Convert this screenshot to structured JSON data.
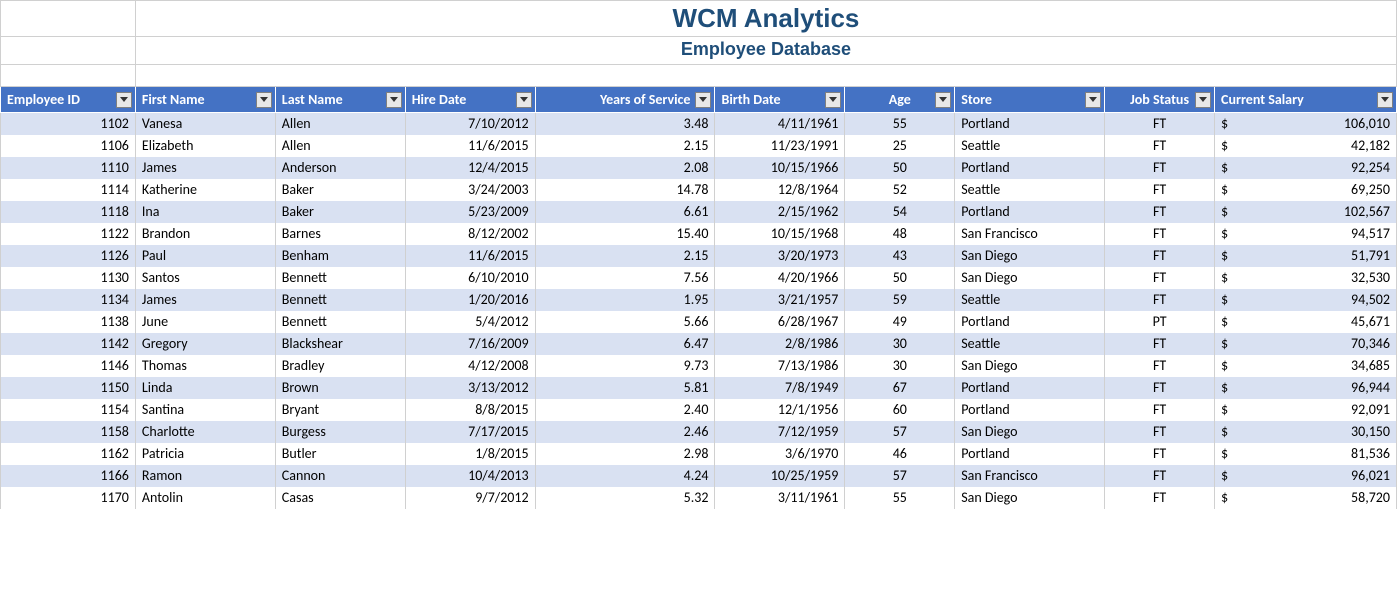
{
  "title": "WCM Analytics",
  "subtitle": "Employee Database",
  "currency_symbol": "$",
  "columns": [
    {
      "key": "emp_id",
      "label": "Employee ID",
      "align": "left"
    },
    {
      "key": "first",
      "label": "First Name",
      "align": "left"
    },
    {
      "key": "last",
      "label": "Last Name",
      "align": "left"
    },
    {
      "key": "hire",
      "label": "Hire Date",
      "align": "left"
    },
    {
      "key": "yos",
      "label": "Years of Service",
      "align": "right"
    },
    {
      "key": "birth",
      "label": "Birth Date",
      "align": "left"
    },
    {
      "key": "age",
      "label": "Age",
      "align": "center"
    },
    {
      "key": "store",
      "label": "Store",
      "align": "left"
    },
    {
      "key": "job",
      "label": "Job Status",
      "align": "center"
    },
    {
      "key": "salary",
      "label": "Current Salary",
      "align": "left"
    }
  ],
  "rows": [
    {
      "emp_id": "1102",
      "first": "Vanesa",
      "last": "Allen",
      "hire": "7/10/2012",
      "yos": "3.48",
      "birth": "4/11/1961",
      "age": "55",
      "store": "Portland",
      "job": "FT",
      "salary": "106,010"
    },
    {
      "emp_id": "1106",
      "first": "Elizabeth",
      "last": "Allen",
      "hire": "11/6/2015",
      "yos": "2.15",
      "birth": "11/23/1991",
      "age": "25",
      "store": "Seattle",
      "job": "FT",
      "salary": "42,182"
    },
    {
      "emp_id": "1110",
      "first": "James",
      "last": "Anderson",
      "hire": "12/4/2015",
      "yos": "2.08",
      "birth": "10/15/1966",
      "age": "50",
      "store": "Portland",
      "job": "FT",
      "salary": "92,254"
    },
    {
      "emp_id": "1114",
      "first": "Katherine",
      "last": "Baker",
      "hire": "3/24/2003",
      "yos": "14.78",
      "birth": "12/8/1964",
      "age": "52",
      "store": "Seattle",
      "job": "FT",
      "salary": "69,250"
    },
    {
      "emp_id": "1118",
      "first": "Ina",
      "last": "Baker",
      "hire": "5/23/2009",
      "yos": "6.61",
      "birth": "2/15/1962",
      "age": "54",
      "store": "Portland",
      "job": "FT",
      "salary": "102,567"
    },
    {
      "emp_id": "1122",
      "first": "Brandon",
      "last": "Barnes",
      "hire": "8/12/2002",
      "yos": "15.40",
      "birth": "10/15/1968",
      "age": "48",
      "store": "San Francisco",
      "job": "FT",
      "salary": "94,517"
    },
    {
      "emp_id": "1126",
      "first": "Paul",
      "last": "Benham",
      "hire": "11/6/2015",
      "yos": "2.15",
      "birth": "3/20/1973",
      "age": "43",
      "store": "San Diego",
      "job": "FT",
      "salary": "51,791"
    },
    {
      "emp_id": "1130",
      "first": "Santos",
      "last": "Bennett",
      "hire": "6/10/2010",
      "yos": "7.56",
      "birth": "4/20/1966",
      "age": "50",
      "store": "San Diego",
      "job": "FT",
      "salary": "32,530"
    },
    {
      "emp_id": "1134",
      "first": "James",
      "last": "Bennett",
      "hire": "1/20/2016",
      "yos": "1.95",
      "birth": "3/21/1957",
      "age": "59",
      "store": "Seattle",
      "job": "FT",
      "salary": "94,502"
    },
    {
      "emp_id": "1138",
      "first": "June",
      "last": "Bennett",
      "hire": "5/4/2012",
      "yos": "5.66",
      "birth": "6/28/1967",
      "age": "49",
      "store": "Portland",
      "job": "PT",
      "salary": "45,671"
    },
    {
      "emp_id": "1142",
      "first": "Gregory",
      "last": "Blackshear",
      "hire": "7/16/2009",
      "yos": "6.47",
      "birth": "2/8/1986",
      "age": "30",
      "store": "Seattle",
      "job": "FT",
      "salary": "70,346"
    },
    {
      "emp_id": "1146",
      "first": "Thomas",
      "last": "Bradley",
      "hire": "4/12/2008",
      "yos": "9.73",
      "birth": "7/13/1986",
      "age": "30",
      "store": "San Diego",
      "job": "FT",
      "salary": "34,685"
    },
    {
      "emp_id": "1150",
      "first": "Linda",
      "last": "Brown",
      "hire": "3/13/2012",
      "yos": "5.81",
      "birth": "7/8/1949",
      "age": "67",
      "store": "Portland",
      "job": "FT",
      "salary": "96,944"
    },
    {
      "emp_id": "1154",
      "first": "Santina",
      "last": "Bryant",
      "hire": "8/8/2015",
      "yos": "2.40",
      "birth": "12/1/1956",
      "age": "60",
      "store": "Portland",
      "job": "FT",
      "salary": "92,091"
    },
    {
      "emp_id": "1158",
      "first": "Charlotte",
      "last": "Burgess",
      "hire": "7/17/2015",
      "yos": "2.46",
      "birth": "7/12/1959",
      "age": "57",
      "store": "San Diego",
      "job": "FT",
      "salary": "30,150"
    },
    {
      "emp_id": "1162",
      "first": "Patricia",
      "last": "Butler",
      "hire": "1/8/2015",
      "yos": "2.98",
      "birth": "3/6/1970",
      "age": "46",
      "store": "Portland",
      "job": "FT",
      "salary": "81,536"
    },
    {
      "emp_id": "1166",
      "first": "Ramon",
      "last": "Cannon",
      "hire": "10/4/2013",
      "yos": "4.24",
      "birth": "10/25/1959",
      "age": "57",
      "store": "San Francisco",
      "job": "FT",
      "salary": "96,021"
    },
    {
      "emp_id": "1170",
      "first": "Antolin",
      "last": "Casas",
      "hire": "9/7/2012",
      "yos": "5.32",
      "birth": "3/11/1961",
      "age": "55",
      "store": "San Diego",
      "job": "FT",
      "salary": "58,720"
    }
  ]
}
